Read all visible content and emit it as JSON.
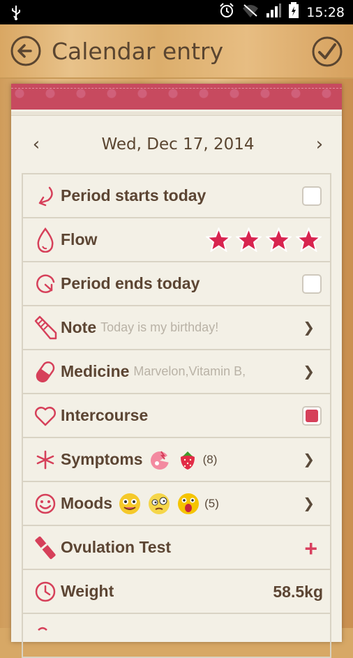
{
  "status": {
    "time": "15:28"
  },
  "header": {
    "title": "Calendar entry"
  },
  "date": {
    "label": "Wed, Dec 17, 2014",
    "prev": "‹",
    "next": "›"
  },
  "rows": [
    {
      "id": "period-start",
      "label": "Period starts today",
      "checked": false
    },
    {
      "id": "flow",
      "label": "Flow",
      "stars": 4
    },
    {
      "id": "period-end",
      "label": "Period ends today",
      "checked": false
    },
    {
      "id": "note",
      "label": "Note",
      "sub": "Today is my birthday!"
    },
    {
      "id": "medicine",
      "label": "Medicine",
      "sub": "Marvelon,Vitamin B,"
    },
    {
      "id": "intercourse",
      "label": "Intercourse",
      "checked": true
    },
    {
      "id": "symptoms",
      "label": "Symptoms",
      "count": "(8)"
    },
    {
      "id": "moods",
      "label": "Moods",
      "count": "(5)"
    },
    {
      "id": "ovulation",
      "label": "Ovulation Test",
      "action": "+"
    },
    {
      "id": "weight",
      "label": "Weight",
      "value": "58.5kg"
    }
  ],
  "colors": {
    "accent": "#d8405f",
    "text": "#5c4533",
    "paper": "#f3f0e6"
  }
}
